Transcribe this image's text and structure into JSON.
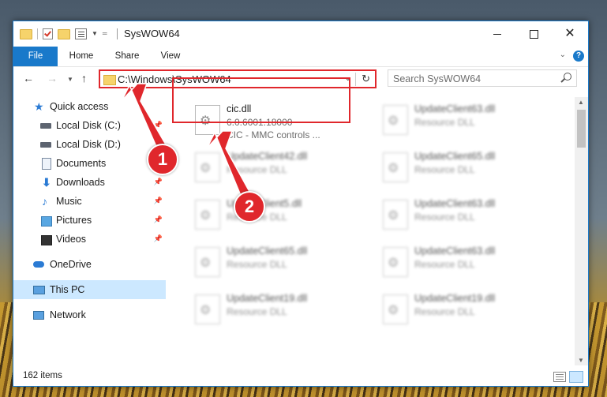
{
  "window": {
    "title": "SysWOW64",
    "controls": {
      "minimize": "minimize-icon",
      "maximize": "maximize-icon",
      "close": "close-icon"
    }
  },
  "ribbon": {
    "tabs": [
      "File",
      "Home",
      "Share",
      "View"
    ],
    "help_label": "?"
  },
  "address": {
    "path": "C:\\Windows\\SysWOW64",
    "search_placeholder": "Search SysWOW64"
  },
  "nav_pane": {
    "items": [
      {
        "label": "Quick access",
        "icon": "star-icon",
        "pinned": false
      },
      {
        "label": "Local Disk (C:)",
        "icon": "drive-icon",
        "pinned": true
      },
      {
        "label": "Local Disk (D:)",
        "icon": "drive-icon",
        "pinned": false
      },
      {
        "label": "Documents",
        "icon": "documents-icon",
        "pinned": true
      },
      {
        "label": "Downloads",
        "icon": "download-icon",
        "pinned": true
      },
      {
        "label": "Music",
        "icon": "music-icon",
        "pinned": true
      },
      {
        "label": "Pictures",
        "icon": "pictures-icon",
        "pinned": true
      },
      {
        "label": "Videos",
        "icon": "videos-icon",
        "pinned": true
      },
      {
        "label": "OneDrive",
        "icon": "cloud-icon",
        "pinned": false
      },
      {
        "label": "This PC",
        "icon": "computer-icon",
        "pinned": false,
        "selected": true
      },
      {
        "label": "Network",
        "icon": "network-icon",
        "pinned": false
      }
    ]
  },
  "files": {
    "highlighted": {
      "name": "cic.dll",
      "version": "6.0.6001.18000",
      "description": "CIC - MMC controls ..."
    },
    "tiles": [
      {
        "name": "UpdateClient63.dll",
        "type": "Resource DLL"
      },
      {
        "name": "UpdateClient42.dll",
        "type": "Resource DLL"
      },
      {
        "name": "UpdateClient65.dll",
        "type": "Resource DLL"
      },
      {
        "name": "UpdateClient5.dll",
        "type": "Resource DLL"
      },
      {
        "name": "UpdateClient63.dll",
        "type": "Resource DLL"
      },
      {
        "name": "UpdateClient65.dll",
        "type": "Resource DLL"
      },
      {
        "name": "UpdateClient63.dll",
        "type": "Resource DLL"
      },
      {
        "name": "UpdateClient19.dll",
        "type": "Resource DLL"
      },
      {
        "name": "UpdateClient19.dll",
        "type": "Resource DLL"
      }
    ]
  },
  "status": {
    "item_count": "162 items"
  },
  "annotations": {
    "marker_1": "1",
    "marker_2": "2",
    "color": "#e0272c"
  },
  "colors": {
    "accent": "#1979ca",
    "selection": "#cce8ff",
    "highlight_border": "#e0272c"
  }
}
